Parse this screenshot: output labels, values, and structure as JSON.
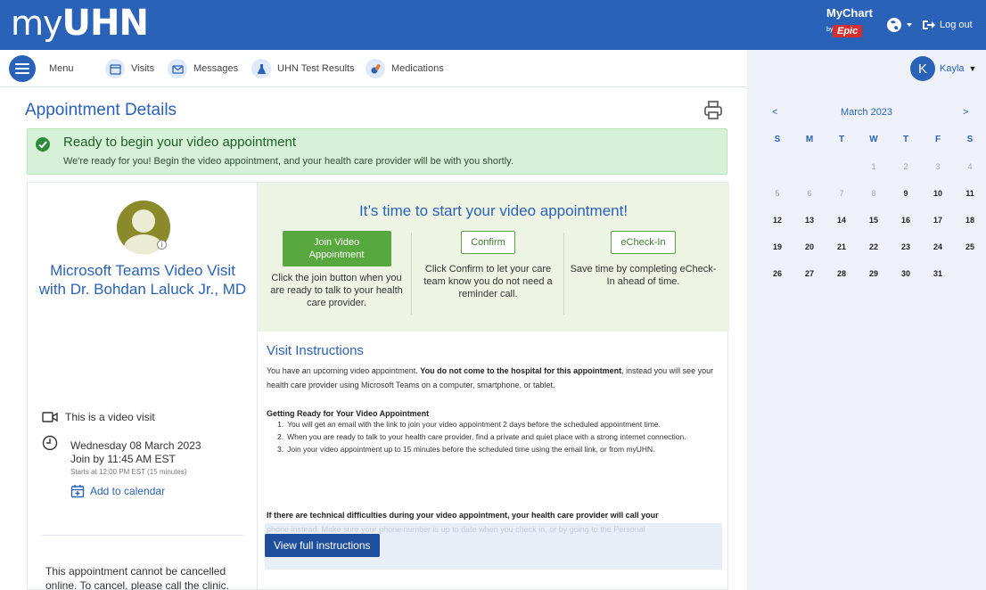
{
  "header": {
    "logo_prefix": "my",
    "logo_suffix": "UHN",
    "mychart_label": "MyChart",
    "epic_label": "Epic",
    "logout_label": "Log out"
  },
  "nav": {
    "menu_label": "Menu",
    "items": [
      {
        "label": "Visits",
        "icon": "visits-icon"
      },
      {
        "label": "Messages",
        "icon": "messages-icon"
      },
      {
        "label": "UHN Test Results",
        "icon": "test-results-icon"
      },
      {
        "label": "Medications",
        "icon": "medications-icon"
      }
    ],
    "user_initial": "K",
    "user_name": "Kayla"
  },
  "page": {
    "title": "Appointment Details"
  },
  "alert": {
    "title": "Ready to begin your video appointment",
    "subtitle": "We're ready for you! Begin the video appointment, and your health care provider will be with you shortly."
  },
  "provider": {
    "visit_title": "Microsoft Teams Video Visit with Dr. Bohdan Laluck Jr., MD",
    "video_note": "This is a video visit",
    "date": "Wednesday 08 March 2023",
    "join_by": "Join by 11:45 AM EST",
    "starts_at": "Starts at 12:00 PM EST (15 minutes)",
    "add_calendar": "Add to calendar",
    "cancel_note": "This appointment cannot be cancelled online. To cancel, please call the clinic."
  },
  "start": {
    "heading": "It’s time to start your video appointment!",
    "join_btn": "Join Video Appointment",
    "join_desc": "Click the join button when you are ready to talk to your health care provider.",
    "confirm_btn": "Confirm",
    "confirm_desc": "Click Confirm to let your care team know you do not need a reminder call.",
    "echeckin_btn": "eCheck-In",
    "echeckin_desc": "Save time by completing eCheck-In ahead of time."
  },
  "instructions": {
    "title": "Visit Instructions",
    "intro_a": "You have an upcoming video appointment. ",
    "intro_bold": "You do not come to the hospital for this appointment",
    "intro_b": ", instead you will see your health care provider using Microsoft Teams on a computer, smartphone, or tablet.",
    "heading": "Getting Ready for Your Video Appointment",
    "steps": [
      "You will get an email with the link to join your video appointment 2 days before the scheduled appointment time.",
      "When you are ready to talk to your health care provider, find a private and quiet place with a strong internet connection.",
      "Join your video appointment up to 15 minutes before the scheduled time using the email link, or from myUHN."
    ],
    "tech_note": "If there are technical difficulties during your video appointment, your health care provider will call your",
    "faded_text": "phone instead. Make sure your phone number is up to date when you check in, or by going to the Personal",
    "view_full_btn": "View full instructions"
  },
  "calendar": {
    "prev": "<",
    "next": ">",
    "month": "March 2023",
    "weekdays": [
      "S",
      "M",
      "T",
      "W",
      "T",
      "F",
      "S"
    ],
    "weeks": [
      [
        "",
        "",
        "",
        "1",
        "2",
        "3",
        "4"
      ],
      [
        "5",
        "6",
        "7",
        "8",
        "9",
        "10",
        "11"
      ],
      [
        "12",
        "13",
        "14",
        "15",
        "16",
        "17",
        "18"
      ],
      [
        "19",
        "20",
        "21",
        "22",
        "23",
        "24",
        "25"
      ],
      [
        "26",
        "27",
        "28",
        "29",
        "30",
        "31",
        ""
      ]
    ],
    "dimmed_through": 8
  },
  "colors": {
    "brand_blue": "#2a62b8",
    "success_green": "#57a83e",
    "alert_bg": "#d6f1d7"
  }
}
